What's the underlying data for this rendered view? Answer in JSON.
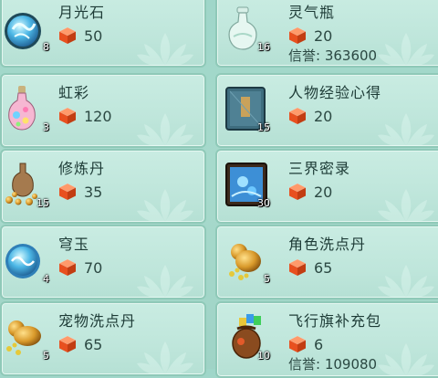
{
  "items": [
    {
      "name": "月光石",
      "qty": "8",
      "price": "50",
      "icon": "moonstone-icon"
    },
    {
      "name": "灵气瓶",
      "qty": "16",
      "price": "20",
      "credit": "信誉: 363600",
      "icon": "spirit-bottle-icon"
    },
    {
      "name": "虹彩",
      "qty": "3",
      "price": "120",
      "icon": "rainbow-potion-icon"
    },
    {
      "name": "人物经验心得",
      "qty": "15",
      "price": "20",
      "icon": "experience-book-icon"
    },
    {
      "name": "修炼丹",
      "qty": "15",
      "price": "35",
      "icon": "cultivation-pill-icon"
    },
    {
      "name": "三界密录",
      "qty": "30",
      "price": "20",
      "icon": "secret-scroll-icon"
    },
    {
      "name": "穹玉",
      "qty": "4",
      "price": "70",
      "icon": "sky-jade-icon"
    },
    {
      "name": "角色洗点丹",
      "qty": "5",
      "price": "65",
      "icon": "gourd-icon"
    },
    {
      "name": "宠物洗点丹",
      "qty": "5",
      "price": "65",
      "icon": "gourd-icon"
    },
    {
      "name": "飞行旗补充包",
      "qty": "10",
      "price": "6",
      "credit": "信誉: 109080",
      "icon": "flag-pack-icon"
    }
  ],
  "colors": {
    "currency": "#e8501f",
    "card_bg": "#c3e8dd",
    "text": "#1d3b36"
  }
}
